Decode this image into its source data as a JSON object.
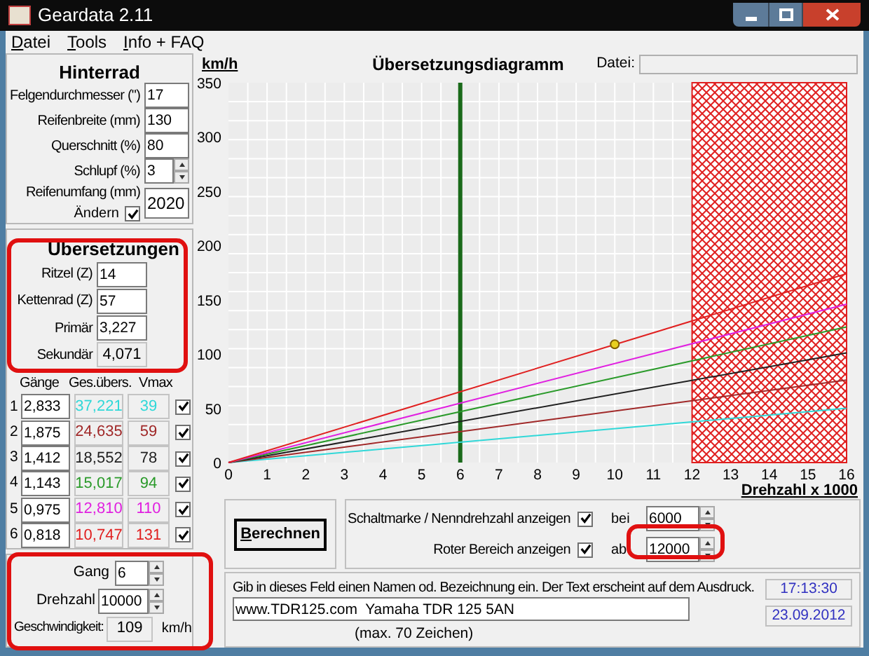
{
  "window": {
    "title": "Geardata 2.11"
  },
  "menu": [
    "Datei",
    "Tools",
    "Info + FAQ"
  ],
  "rear_wheel": {
    "title": "Hinterrad",
    "fields": [
      {
        "label": "Felgendurchmesser (\")",
        "value": "17",
        "kind": "text"
      },
      {
        "label": "Reifenbreite (mm)",
        "value": "130",
        "kind": "text"
      },
      {
        "label": "Querschnitt (%)",
        "value": "80",
        "kind": "text"
      },
      {
        "label": "Schlupf (%)",
        "value": "3",
        "kind": "spinner"
      }
    ],
    "circumference": {
      "label": "Reifenumfang (mm)",
      "value": "2020",
      "change_label": "Ändern",
      "change_checked": true
    }
  },
  "ratios": {
    "title": "Übersetzungen",
    "fields": [
      {
        "label": "Ritzel (Z)",
        "value": "14",
        "kind": "input"
      },
      {
        "label": "Kettenrad (Z)",
        "value": "57",
        "kind": "input"
      },
      {
        "label": "Primär",
        "value": "3,227",
        "kind": "input"
      },
      {
        "label": "Sekundär",
        "value": "4,071",
        "kind": "readout"
      }
    ]
  },
  "gears": {
    "columns": [
      "Gänge",
      "Ges.übers.",
      "Vmax"
    ],
    "rows": [
      {
        "number": "1",
        "ratio": "2,833",
        "total": "37,221",
        "vmax": "39",
        "color": "#30d8d8",
        "checked": true
      },
      {
        "number": "2",
        "ratio": "1,875",
        "total": "24,635",
        "vmax": "59",
        "color": "#a02828",
        "checked": true
      },
      {
        "number": "3",
        "ratio": "1,412",
        "total": "18,552",
        "vmax": "78",
        "color": "#202020",
        "checked": true
      },
      {
        "number": "4",
        "ratio": "1,143",
        "total": "15,017",
        "vmax": "94",
        "color": "#2a9a2a",
        "checked": true
      },
      {
        "number": "5",
        "ratio": "0,975",
        "total": "12,810",
        "vmax": "110",
        "color": "#e020e0",
        "checked": true
      },
      {
        "number": "6",
        "ratio": "0,818",
        "total": "10,747",
        "vmax": "131",
        "color": "#e02020",
        "checked": true
      }
    ]
  },
  "calculator": {
    "gear_label": "Gang",
    "gear": "6",
    "rpm_label": "Drehzahl",
    "rpm": "10000",
    "speed_label": "Geschwindigkeit:",
    "speed": "109",
    "unit": "km/h"
  },
  "chart": {
    "file_label": "Datei:",
    "chart_data": {
      "type": "line",
      "title": "Übersetzungsdiagramm",
      "xlabel": "Drehzahl x 1000",
      "ylabel": "km/h",
      "x": [
        0,
        16
      ],
      "series": [
        {
          "color": "#30d8d8",
          "values": [
            0,
            50
          ]
        },
        {
          "color": "#a02828",
          "values": [
            0,
            76
          ]
        },
        {
          "color": "#202020",
          "values": [
            0,
            101
          ]
        },
        {
          "color": "#2a9a2a",
          "values": [
            0,
            125
          ]
        },
        {
          "color": "#e020e0",
          "values": [
            0,
            146
          ]
        },
        {
          "color": "#e02020",
          "values": [
            0,
            174
          ]
        }
      ],
      "xlim": [
        0,
        16
      ],
      "ylim": [
        0,
        350
      ],
      "xticks": [
        0,
        1,
        2,
        3,
        4,
        5,
        6,
        7,
        8,
        9,
        10,
        11,
        12,
        13,
        14,
        15,
        16
      ],
      "yticks": [
        0,
        50,
        100,
        150,
        200,
        250,
        300,
        350
      ],
      "grid": true,
      "ref_lines": [
        {
          "axis": "x",
          "value": 6,
          "color": "#1a6a1a"
        }
      ],
      "bands": [
        {
          "axis": "x",
          "from": 12,
          "to": 16,
          "color": "#e02020"
        }
      ]
    }
  },
  "calculate_button": "Berechnen",
  "options": [
    {
      "label": "Schaltmarke / Nenndrehzahl anzeigen",
      "checked": true,
      "prep": "bei",
      "value": "6000"
    },
    {
      "label": "Roter Bereich anzeigen",
      "checked": true,
      "prep": "ab",
      "value": "12000"
    }
  ],
  "note": {
    "hint": "Gib in dieses Feld einen Namen od. Bezeichnung ein. Der Text erscheint auf dem Ausdruck.",
    "value": "www.TDR125.com  Yamaha TDR 125 5AN",
    "limit": "(max. 70 Zeichen)"
  },
  "time": "17:13:30",
  "date": "23.09.2012"
}
